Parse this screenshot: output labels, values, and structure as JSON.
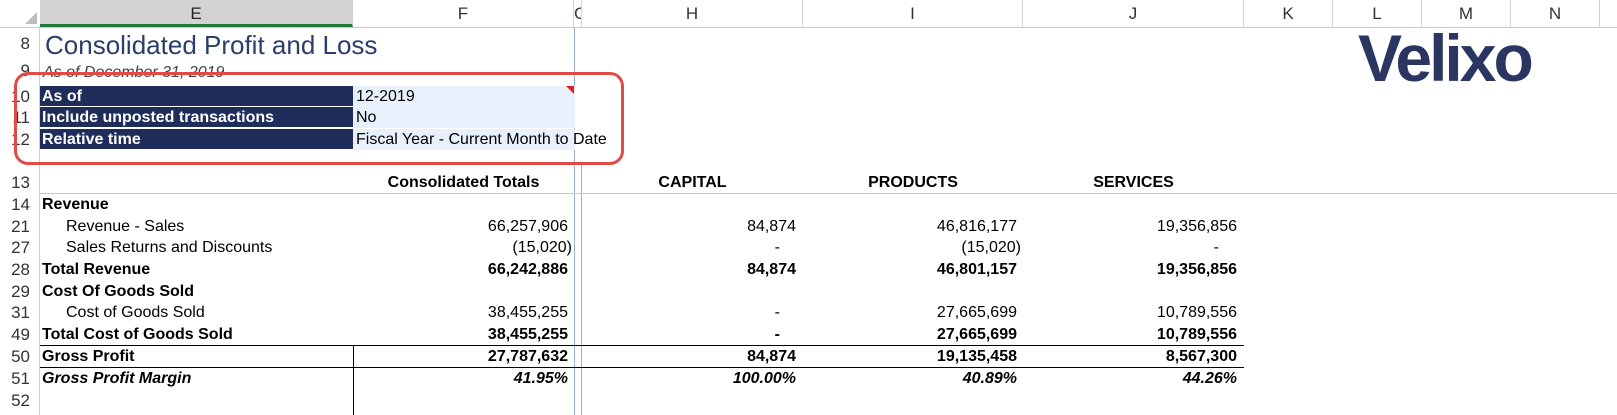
{
  "columns": [
    "E",
    "F",
    "G",
    "H",
    "I",
    "J",
    "K",
    "L",
    "M",
    "N"
  ],
  "rows": [
    "8",
    "9",
    "10",
    "11",
    "12",
    "13",
    "14",
    "21",
    "27",
    "28",
    "29",
    "31",
    "49",
    "50",
    "51",
    "52"
  ],
  "report": {
    "title": "Consolidated Profit and Loss",
    "subtitle": "As of December 31, 2019",
    "logo": "Velixo"
  },
  "params": [
    {
      "label": "As of",
      "value": "12-2019"
    },
    {
      "label": "Include unposted transactions",
      "value": "No"
    },
    {
      "label": "Relative time",
      "value": "Fiscal Year - Current Month to Date"
    }
  ],
  "table": {
    "headers": [
      "Consolidated Totals",
      "CAPITAL",
      "PRODUCTS",
      "SERVICES"
    ],
    "rows": [
      {
        "label": "Revenue",
        "values": [
          "",
          "",
          "",
          ""
        ]
      },
      {
        "label": "Revenue - Sales",
        "values": [
          "66,257,906",
          "84,874",
          "46,816,177",
          "19,356,856"
        ]
      },
      {
        "label": "Sales Returns and Discounts",
        "values": [
          "(15,020)",
          "-",
          "(15,020)",
          "-"
        ]
      },
      {
        "label": "Total Revenue",
        "values": [
          "66,242,886",
          "84,874",
          "46,801,157",
          "19,356,856"
        ]
      },
      {
        "label": "Cost Of Goods Sold",
        "values": [
          "",
          "",
          "",
          ""
        ]
      },
      {
        "label": "Cost of Goods Sold",
        "values": [
          "38,455,255",
          "-",
          "27,665,699",
          "10,789,556"
        ]
      },
      {
        "label": "Total Cost of Goods Sold",
        "values": [
          "38,455,255",
          "-",
          "27,665,699",
          "10,789,556"
        ]
      },
      {
        "label": "Gross Profit",
        "values": [
          "27,787,632",
          "84,874",
          "19,135,458",
          "8,567,300"
        ]
      },
      {
        "label": "Gross Profit Margin",
        "values": [
          "41.95%",
          "100.00%",
          "40.89%",
          "44.26%"
        ]
      }
    ]
  }
}
